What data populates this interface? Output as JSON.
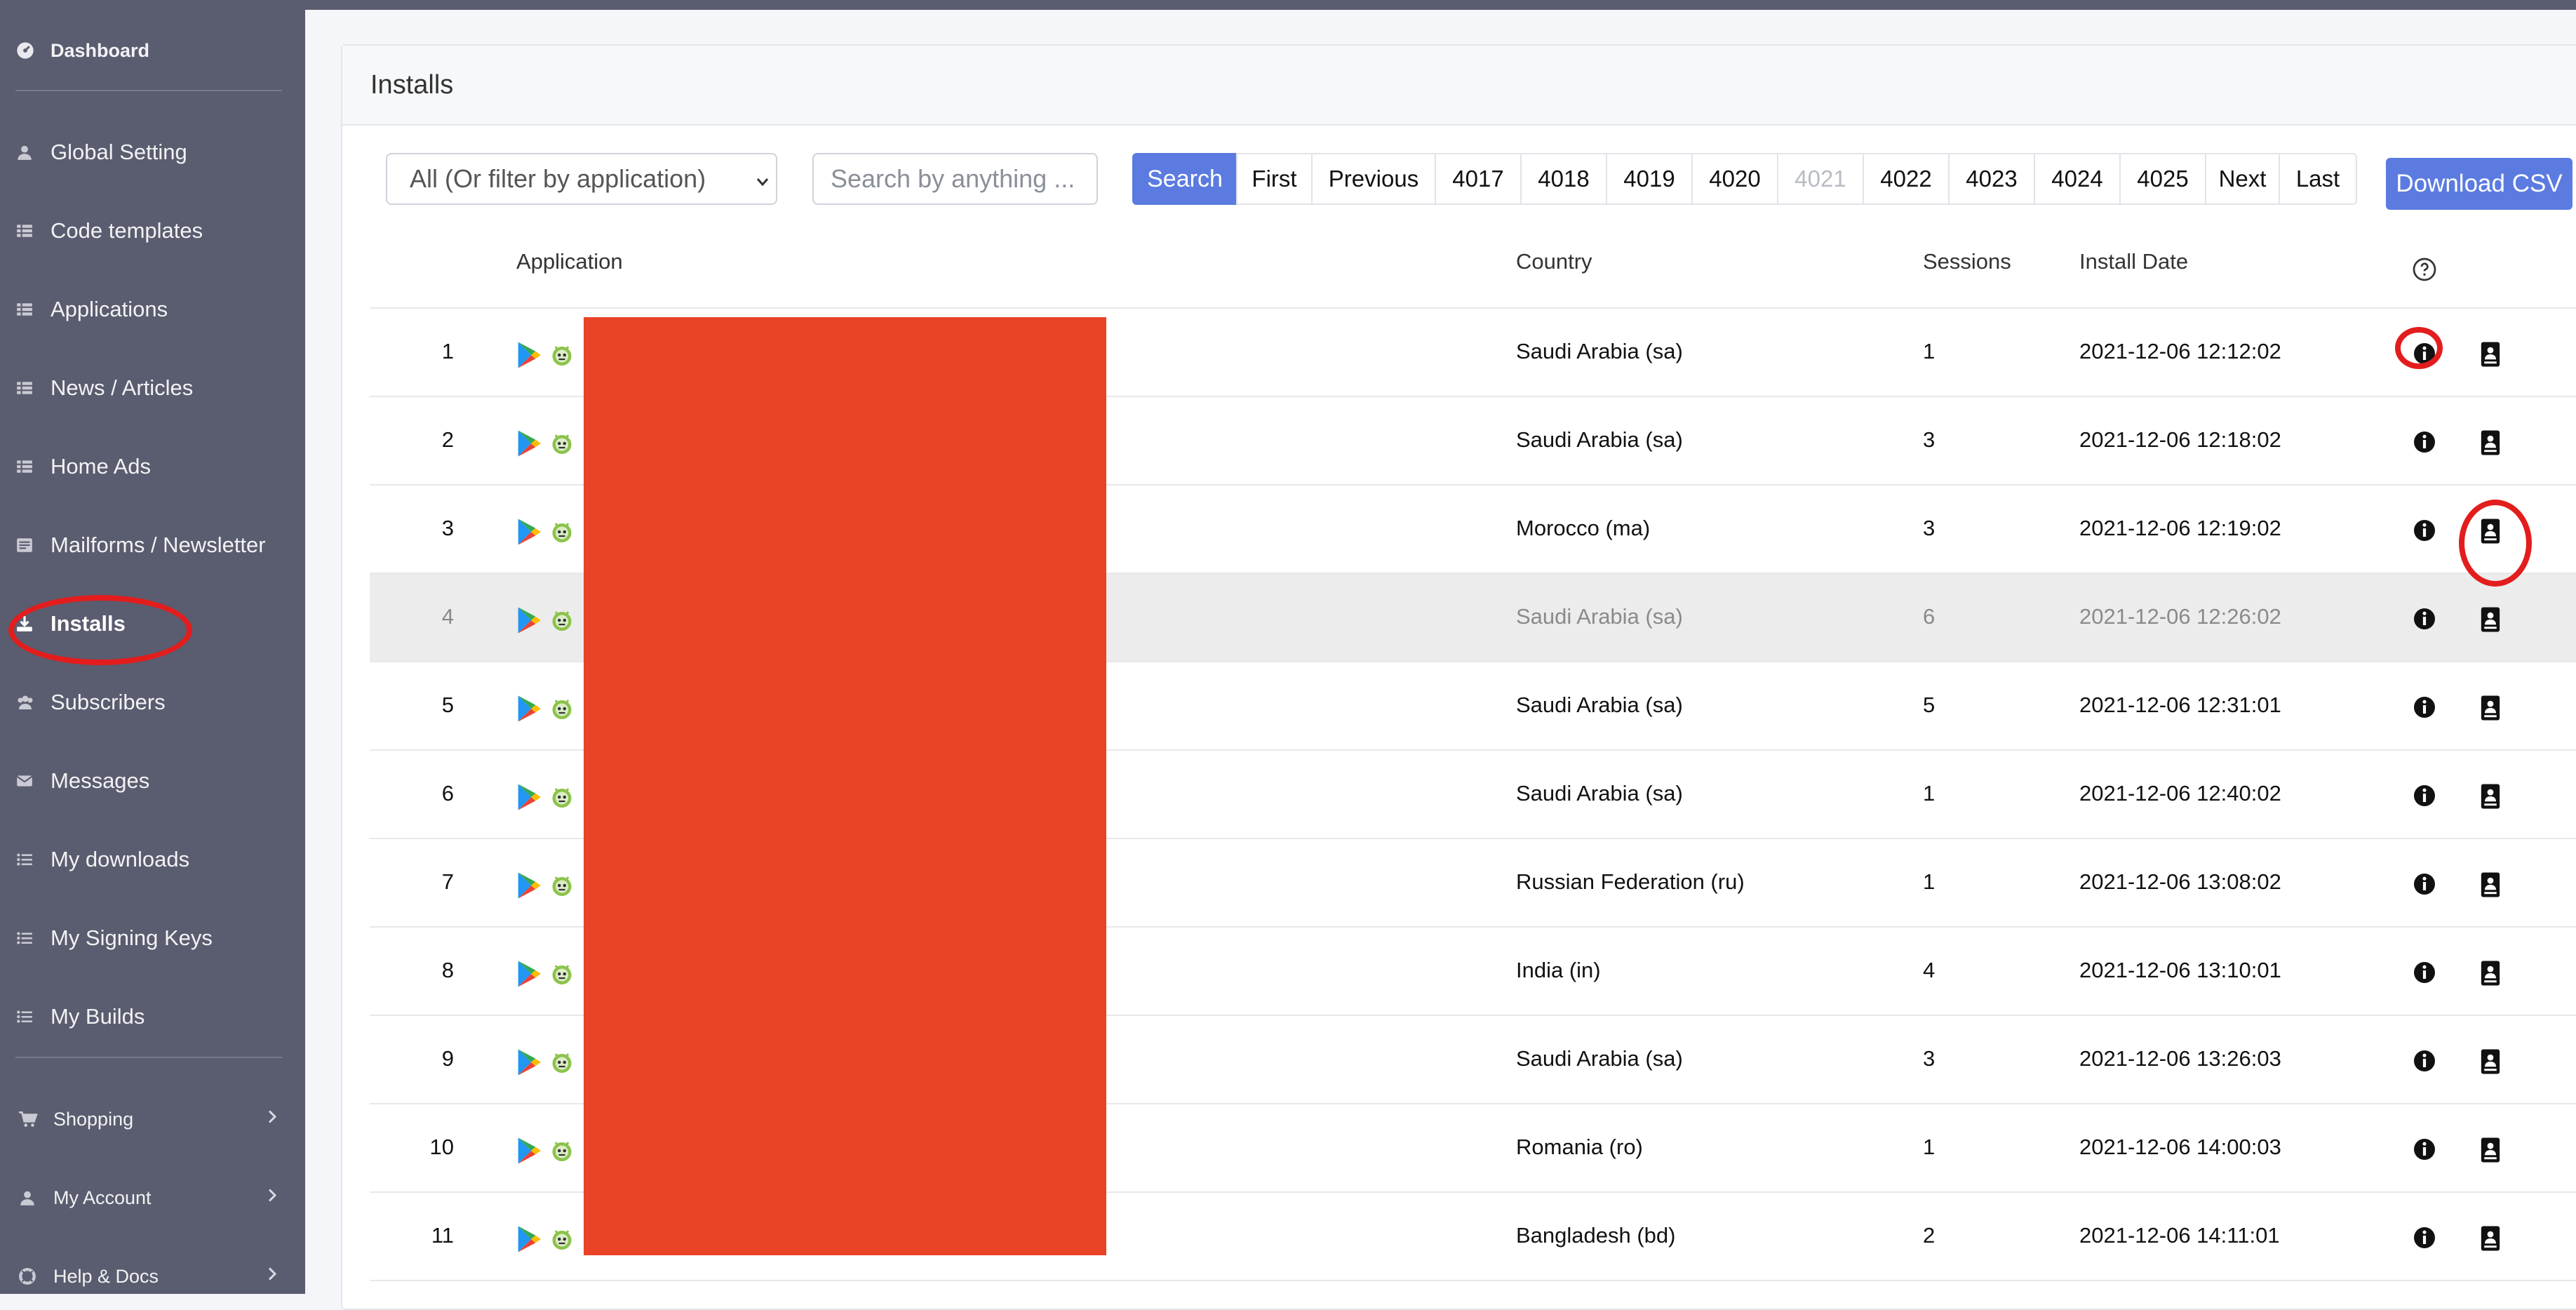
{
  "sidebar": {
    "dashboard": "Dashboard",
    "items": [
      {
        "label": "Global Setting",
        "icon": "user-icon"
      },
      {
        "label": "Code templates",
        "icon": "list-icon"
      },
      {
        "label": "Applications",
        "icon": "list-icon"
      },
      {
        "label": "News / Articles",
        "icon": "list-icon"
      },
      {
        "label": "Home Ads",
        "icon": "list-icon"
      },
      {
        "label": "Mailforms / Newsletter",
        "icon": "mail-list-icon"
      },
      {
        "label": "Installs",
        "icon": "download-icon",
        "active": true
      },
      {
        "label": "Subscribers",
        "icon": "users-icon"
      },
      {
        "label": "Messages",
        "icon": "envelope-icon"
      },
      {
        "label": "My downloads",
        "icon": "bullet-list-icon"
      },
      {
        "label": "My Signing Keys",
        "icon": "bullet-list-icon"
      },
      {
        "label": "My Builds",
        "icon": "bullet-list-icon"
      }
    ],
    "bottom": [
      {
        "label": "Shopping",
        "icon": "cart-icon"
      },
      {
        "label": "My Account",
        "icon": "user-icon"
      },
      {
        "label": "Help & Docs",
        "icon": "lifebuoy-icon"
      }
    ]
  },
  "page": {
    "title": "Installs"
  },
  "filters": {
    "app_select": "All (Or filter by application)",
    "search_placeholder": "Search by anything ...",
    "search_button": "Search"
  },
  "pagination": [
    {
      "label": "First"
    },
    {
      "label": "Previous"
    },
    {
      "label": "4017"
    },
    {
      "label": "4018"
    },
    {
      "label": "4019"
    },
    {
      "label": "4020"
    },
    {
      "label": "4021",
      "current": true
    },
    {
      "label": "4022"
    },
    {
      "label": "4023"
    },
    {
      "label": "4024"
    },
    {
      "label": "4025"
    },
    {
      "label": "Next"
    },
    {
      "label": "Last"
    }
  ],
  "download_csv": "Download CSV",
  "table": {
    "headers": {
      "application": "Application",
      "country": "Country",
      "sessions": "Sessions",
      "install_date": "Install Date"
    },
    "rows": [
      {
        "n": "1",
        "country": "Saudi Arabia (sa)",
        "sessions": "1",
        "date": "2021-12-06 12:12:02"
      },
      {
        "n": "2",
        "country": "Saudi Arabia (sa)",
        "sessions": "3",
        "date": "2021-12-06 12:18:02"
      },
      {
        "n": "3",
        "country": "Morocco (ma)",
        "sessions": "3",
        "date": "2021-12-06 12:19:02"
      },
      {
        "n": "4",
        "country": "Saudi Arabia (sa)",
        "sessions": "6",
        "date": "2021-12-06 12:26:02",
        "highlight": true
      },
      {
        "n": "5",
        "country": "Saudi Arabia (sa)",
        "sessions": "5",
        "date": "2021-12-06 12:31:01"
      },
      {
        "n": "6",
        "country": "Saudi Arabia (sa)",
        "sessions": "1",
        "date": "2021-12-06 12:40:02"
      },
      {
        "n": "7",
        "country": "Russian Federation (ru)",
        "sessions": "1",
        "date": "2021-12-06 13:08:02"
      },
      {
        "n": "8",
        "country": "India (in)",
        "sessions": "4",
        "date": "2021-12-06 13:10:01"
      },
      {
        "n": "9",
        "country": "Saudi Arabia (sa)",
        "sessions": "3",
        "date": "2021-12-06 13:26:03"
      },
      {
        "n": "10",
        "country": "Romania (ro)",
        "sessions": "1",
        "date": "2021-12-06 14:00:03"
      },
      {
        "n": "11",
        "country": "Bangladesh (bd)",
        "sessions": "2",
        "date": "2021-12-06 14:11:01"
      }
    ]
  },
  "colors": {
    "accent": "#5b7be0",
    "sidebar": "#5a5c6f",
    "redaction": "#e94328",
    "annotation": "#e31d1d"
  }
}
